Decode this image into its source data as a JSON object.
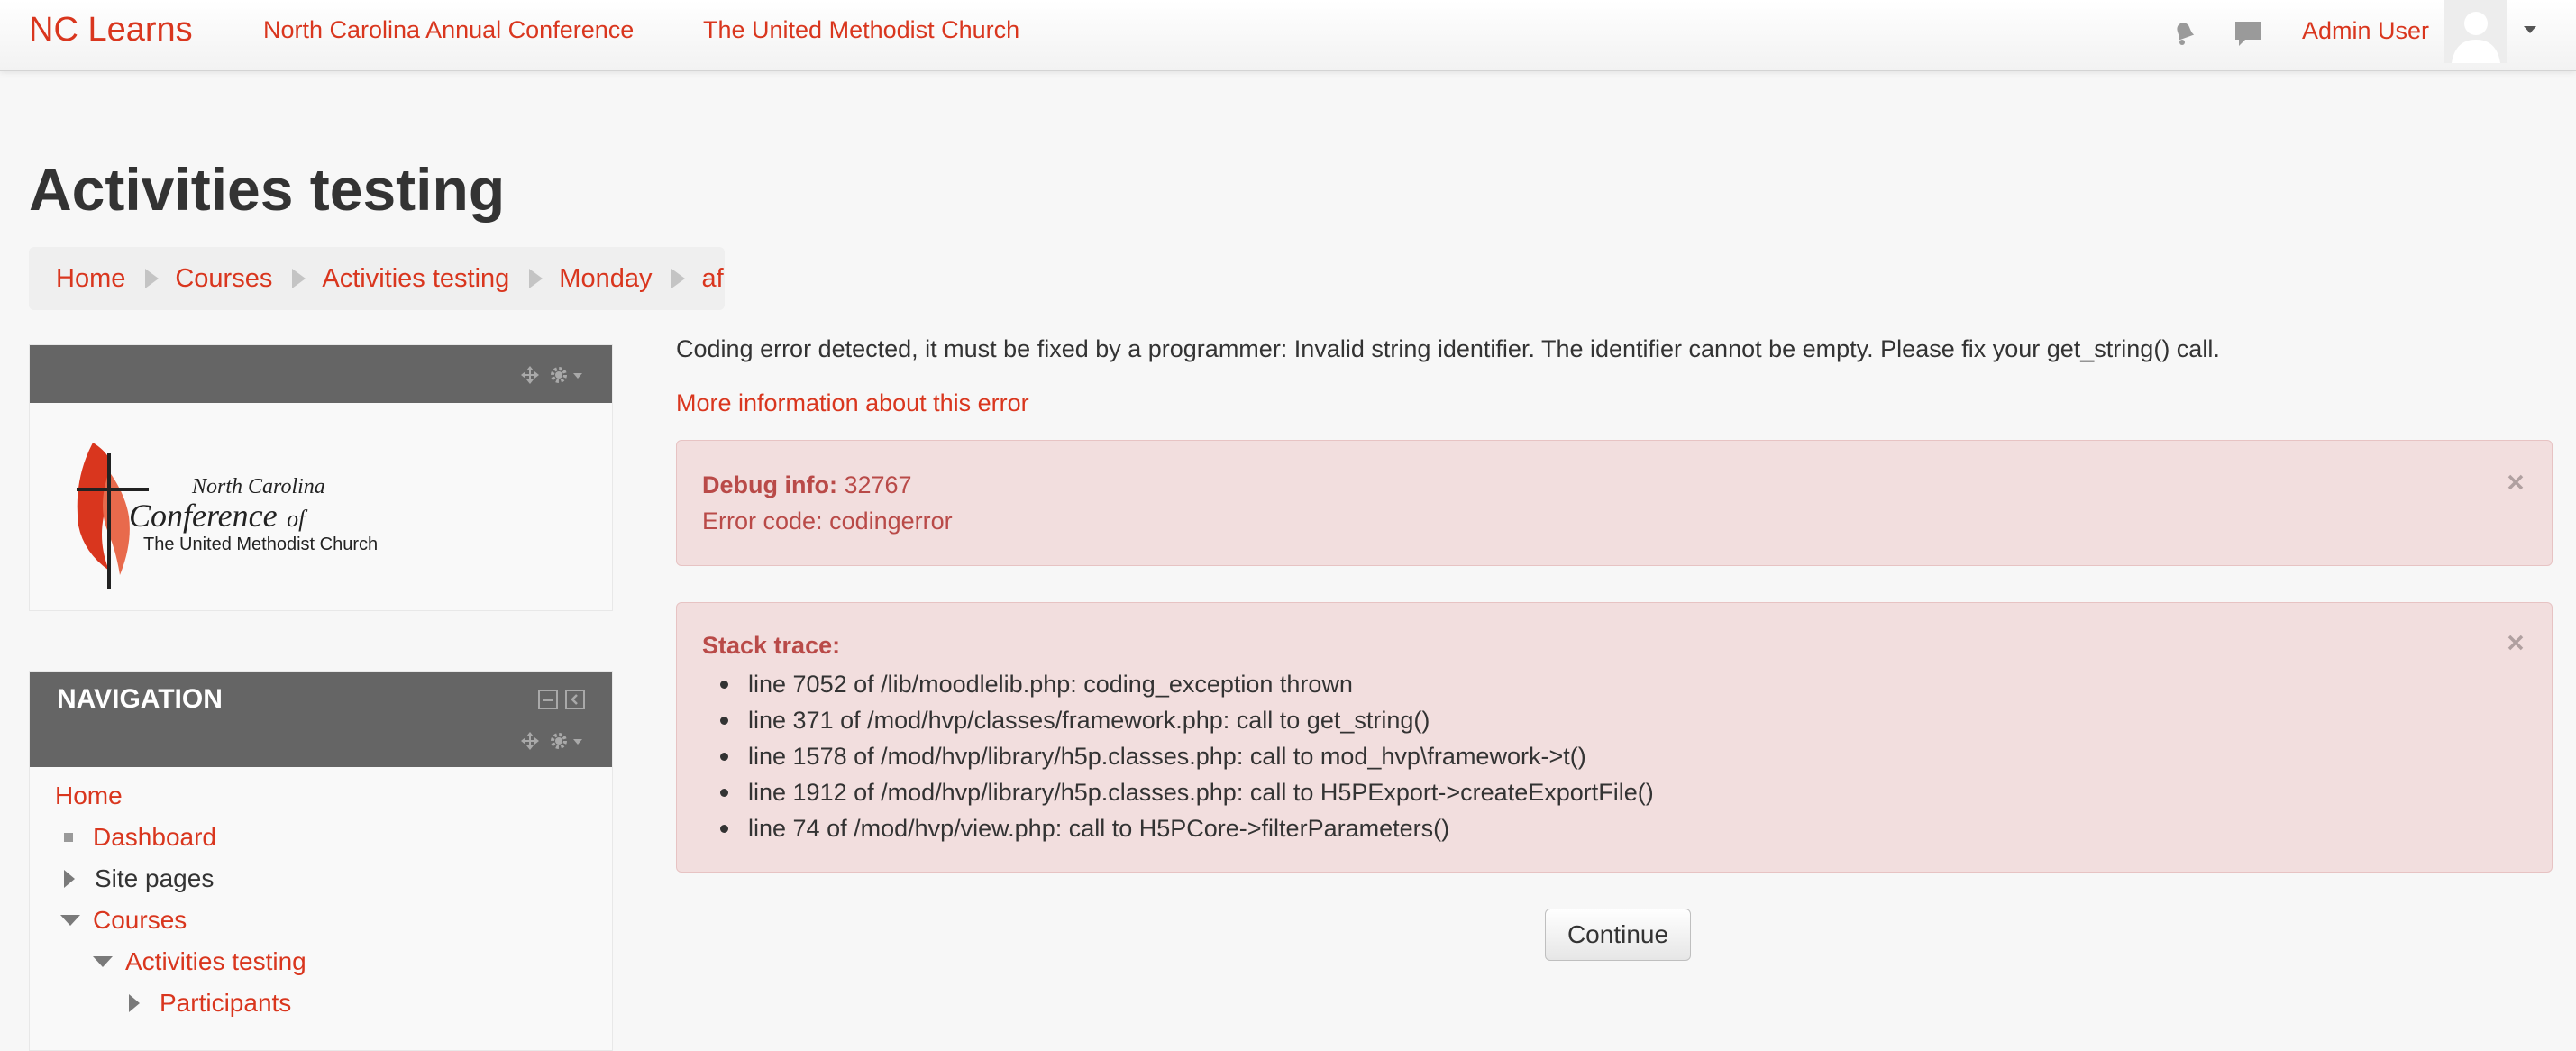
{
  "navbar": {
    "brand": "NC Learns",
    "links": [
      "North Carolina Annual Conference",
      "The United Methodist Church"
    ],
    "user_name": "Admin User"
  },
  "page": {
    "title": "Activities testing"
  },
  "breadcrumb": [
    "Home",
    "Courses",
    "Activities testing",
    "Monday",
    "af"
  ],
  "logo_block": {
    "line1": "North Carolina",
    "line2": "Conference",
    "line2_suffix": "of",
    "line3": "The United Methodist Church"
  },
  "navigation": {
    "title": "NAVIGATION",
    "items": [
      {
        "label": "Home",
        "link": true,
        "icon": "none",
        "level": 0
      },
      {
        "label": "Dashboard",
        "link": true,
        "icon": "bullet",
        "level": 1
      },
      {
        "label": "Site pages",
        "link": false,
        "icon": "collapsed",
        "level": 1
      },
      {
        "label": "Courses",
        "link": true,
        "icon": "expanded",
        "level": 1
      },
      {
        "label": "Activities testing",
        "link": true,
        "icon": "expanded",
        "level": 2
      },
      {
        "label": "Participants",
        "link": true,
        "icon": "collapsed",
        "level": 3
      }
    ]
  },
  "error": {
    "message": "Coding error detected, it must be fixed by a programmer: Invalid string identifier. The identifier cannot be empty. Please fix your get_string() call.",
    "more_info": "More information about this error",
    "debug_label": "Debug info:",
    "debug_value": "32767",
    "error_code_label": "Error code:",
    "error_code_value": "codingerror",
    "trace_title": "Stack trace:",
    "trace": [
      "line 7052 of /lib/moodlelib.php: coding_exception thrown",
      "line 371 of /mod/hvp/classes/framework.php: call to get_string()",
      "line 1578 of /mod/hvp/library/h5p.classes.php: call to mod_hvp\\framework->t()",
      "line 1912 of /mod/hvp/library/h5p.classes.php: call to H5PExport->createExportFile()",
      "line 74 of /mod/hvp/view.php: call to H5PCore->filterParameters()"
    ],
    "continue_label": "Continue"
  },
  "colors": {
    "accent": "#d9361e",
    "alert_bg": "#f2dede",
    "alert_text": "#b94a48",
    "block_header": "#656565"
  }
}
